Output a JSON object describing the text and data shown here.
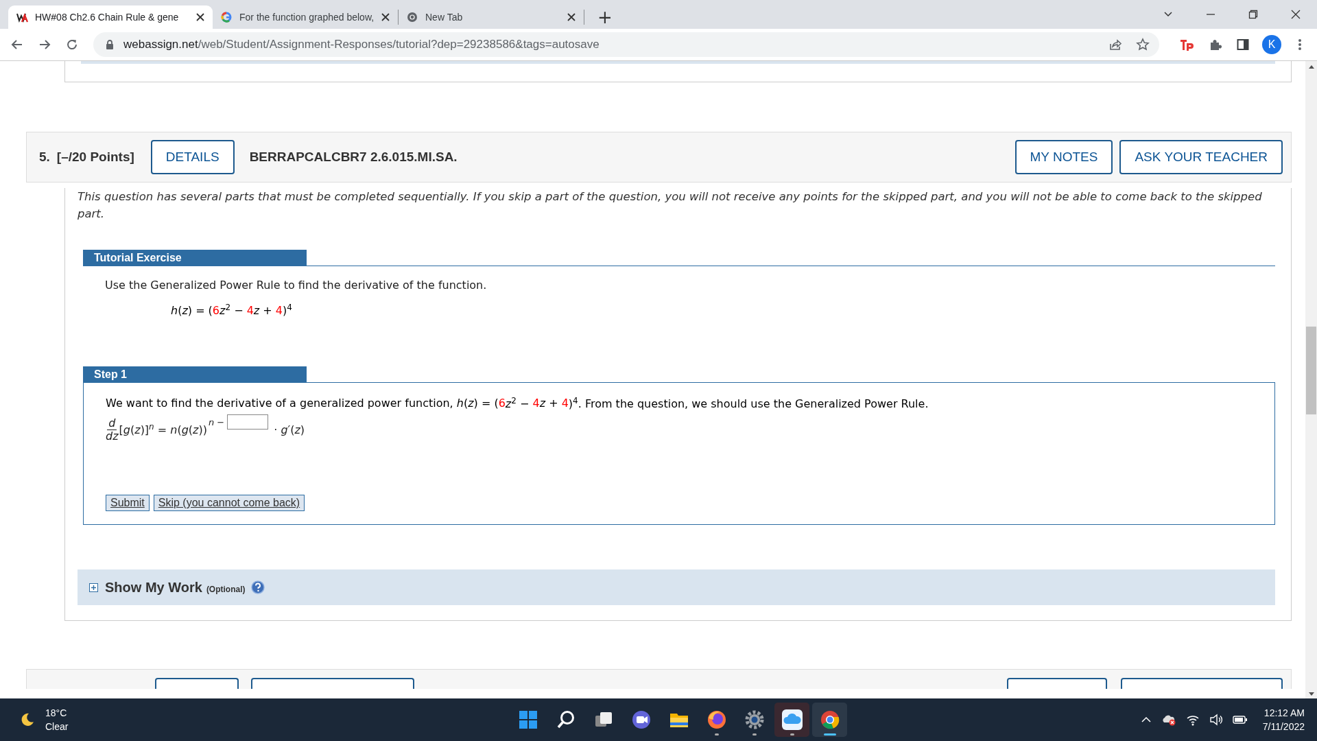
{
  "browser": {
    "tabs": [
      {
        "title": "HW#08 Ch2.6 Chain Rule & gene",
        "selected": true,
        "kind": "webassign"
      },
      {
        "title": "For the function graphed below, ",
        "selected": false,
        "kind": "google"
      },
      {
        "title": "New Tab",
        "selected": false,
        "kind": "chrome"
      }
    ],
    "new_tab": "+",
    "url": {
      "host": "webassign.net",
      "path": "/web/Student/Assignment-Responses/tutorial?dep=29238586&tags=autosave"
    },
    "profile": "K"
  },
  "question": {
    "number": "5.",
    "points": "[–/20 Points]",
    "details": "DETAILS",
    "code": "BERRAPCALCBR7 2.6.015.MI.SA.",
    "my_notes": "MY NOTES",
    "ask": "ASK YOUR TEACHER",
    "notice": "This question has several parts that must be completed sequentially. If you skip a part of the question, you will not receive any points for the skipped part, and you will not be able to come back to the skipped part.",
    "tutorial": {
      "heading": "Tutorial Exercise",
      "prompt": "Use the Generalized Power Rule to find the derivative of the function.",
      "formula": [
        {
          "text": "*h*(*z*) = (",
          "color": "#000000"
        },
        {
          "text": "6",
          "color": "#ff0000"
        },
        {
          "text": "*z*$^{2}$ − ",
          "color": "#000000"
        },
        {
          "text": "4",
          "color": "#ff0000"
        },
        {
          "text": "*z* + ",
          "color": "#000000"
        },
        {
          "text": "4",
          "color": "#ff0000"
        },
        {
          "text": ")$^{4}$",
          "color": "#000000"
        }
      ]
    },
    "step": {
      "heading": "Step 1",
      "sentence": [
        {
          "text": "We want to find the derivative of a generalized power function, *h*(*z*) = (",
          "color": "#000000"
        },
        {
          "text": "6",
          "color": "#ff0000"
        },
        {
          "text": "*z*$^{2}$ − ",
          "color": "#000000"
        },
        {
          "text": "4",
          "color": "#ff0000"
        },
        {
          "text": "*z* + ",
          "color": "#000000"
        },
        {
          "text": "4",
          "color": "#ff0000"
        },
        {
          "text": ")$^{4}$. From the question, we should use the Generalized Power Rule.",
          "color": "#000000"
        }
      ],
      "rule": {
        "numerator": "d",
        "denominator": "dz",
        "lhs": "[*g*(*z*)]",
        "lhs_exponent": "n",
        "rhs": "= *n*(*g*(*z*))",
        "exponent": "n −",
        "tail": "· *g*′(*z*)"
      },
      "buttons": [
        "Submit",
        "Skip (you cannot come back)"
      ]
    },
    "show_my_work": {
      "label": "Show My Work",
      "note": "(Optional)",
      "expanded": false
    }
  },
  "next_question": {
    "buttons": [
      {
        "kind": "details"
      },
      {
        "kind": "previous"
      },
      {
        "kind": "notes"
      },
      {
        "kind": "ask"
      }
    ]
  },
  "taskbar": {
    "temperature": "18°C",
    "condition": "Clear",
    "apps": [
      {
        "kind": "start",
        "running": false,
        "selected": false
      },
      {
        "kind": "search",
        "running": false,
        "selected": false
      },
      {
        "kind": "taskview",
        "running": false,
        "selected": false
      },
      {
        "kind": "chat",
        "running": false,
        "selected": false
      },
      {
        "kind": "files",
        "running": false,
        "selected": false
      },
      {
        "kind": "firefox",
        "running": true,
        "selected": false
      },
      {
        "kind": "settings",
        "running": true,
        "selected": false
      },
      {
        "kind": "cloud",
        "running": true,
        "selected": false
      },
      {
        "kind": "chrome",
        "running": true,
        "selected": true
      }
    ],
    "time": "12:12 AM",
    "date": "7/11/2022"
  }
}
